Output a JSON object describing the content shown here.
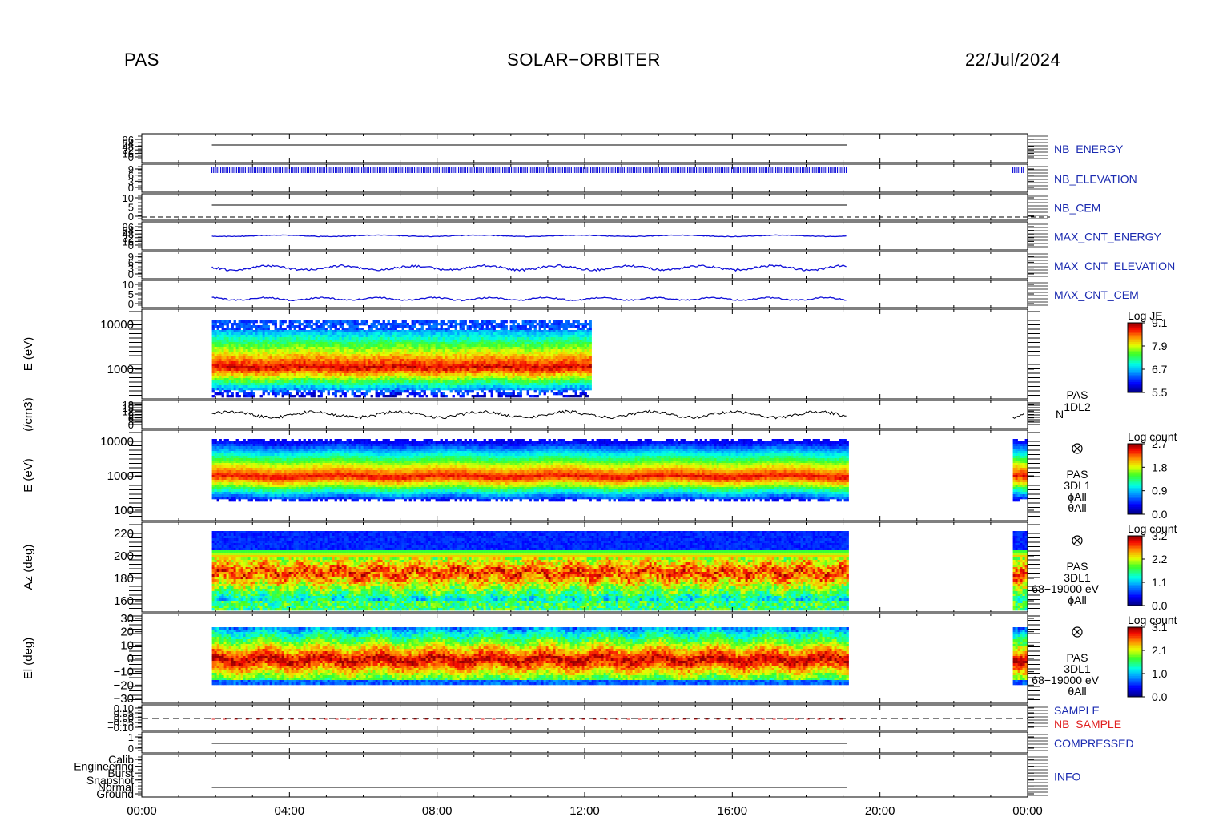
{
  "header": {
    "instrument": "PAS",
    "mission": "SOLAR−ORBITER",
    "date": "22/Jul/2024"
  },
  "colors": {
    "hk_label": "#1a2ab0",
    "nb_sample_label": "#e02020",
    "trace": "#1010d8",
    "density_trace": "#000000",
    "gap_zero_line": "#000000"
  },
  "chart_data": {
    "type": "heatmap",
    "x_axis": {
      "ticks": [
        "00:00",
        "04:00",
        "08:00",
        "12:00",
        "16:00",
        "20:00",
        "00:00"
      ],
      "range_hours": [
        0,
        24
      ]
    },
    "data_intervals_hours": {
      "main": [
        1.9,
        19.1
      ],
      "e_spectrogram_l2": [
        1.9,
        12.15
      ],
      "late": [
        23.6,
        24.0
      ]
    },
    "panels": [
      {
        "id": "nb_energy",
        "label": "NB_ENERGY",
        "kind": "line",
        "ticks": [
          "96",
          "64",
          "48",
          "32",
          "16",
          "0"
        ]
      },
      {
        "id": "nb_elevation",
        "label": "NB_ELEVATION",
        "kind": "comb",
        "ticks": [
          "9",
          "6",
          "3",
          "0"
        ]
      },
      {
        "id": "nb_cem",
        "label": "NB_CEM",
        "kind": "line",
        "ticks": [
          "10",
          "5",
          "0"
        ]
      },
      {
        "id": "max_cnt_energy",
        "label": "MAX_CNT_ENERGY",
        "kind": "line",
        "ticks": [
          "96",
          "64",
          "48",
          "32",
          "16",
          "0"
        ]
      },
      {
        "id": "max_cnt_elevation",
        "label": "MAX_CNT_ELEVATION",
        "kind": "line",
        "ticks": [
          "9",
          "6",
          "3",
          "0"
        ]
      },
      {
        "id": "max_cnt_cem",
        "label": "MAX_CNT_CEM",
        "kind": "line",
        "ticks": [
          "10",
          "5",
          "0"
        ]
      },
      {
        "id": "energy_l2",
        "kind": "spectrogram",
        "ylabel": "E (eV)",
        "yscale": "log",
        "yticks": [
          "10000",
          "1000"
        ],
        "ylim": [
          250,
          11000
        ],
        "peak_ev": 1000,
        "colorbar": {
          "title": "Log JE",
          "ticks": [
            "9.1",
            "7.9",
            "6.7",
            "5.5"
          ],
          "range": [
            5.5,
            9.1
          ]
        }
      },
      {
        "id": "density",
        "kind": "line",
        "ylabel": "(/cm3)",
        "yticks": [
          "18",
          "15",
          "12",
          "9",
          "6",
          "3",
          "0"
        ],
        "side_labels": [
          "PAS",
          "1DL2",
          "N"
        ]
      },
      {
        "id": "energy_l1",
        "kind": "spectrogram",
        "ylabel": "E (eV)",
        "yscale": "log",
        "yticks": [
          "10000",
          "1000",
          "100"
        ],
        "ylim": [
          80,
          12000
        ],
        "peak_ev": 1000,
        "colorbar": {
          "title": "Log count",
          "ticks": [
            "2.7",
            "1.8",
            "0.9",
            "0.0"
          ],
          "range": [
            0.0,
            2.7
          ]
        },
        "side_labels": [
          "PAS",
          "3DL1",
          "ϕAll",
          "θAll"
        ]
      },
      {
        "id": "azimuth",
        "kind": "spectrogram",
        "ylabel": "Az (deg)",
        "yticks": [
          "220",
          "200",
          "180",
          "160"
        ],
        "ylim": [
          155,
          226
        ],
        "colorbar": {
          "title": "Log count",
          "ticks": [
            "3.2",
            "2.2",
            "1.1",
            "0.0"
          ],
          "range": [
            0.0,
            3.2
          ]
        },
        "side_labels": [
          "PAS",
          "3DL1",
          "68−19000 eV",
          "ϕAll"
        ]
      },
      {
        "id": "elevation",
        "kind": "spectrogram",
        "ylabel": "El (deg)",
        "yticks": [
          "30",
          "20",
          "10",
          "0",
          "−10",
          "−20",
          "−30"
        ],
        "ylim": [
          -30,
          30
        ],
        "colorbar": {
          "title": "Log count",
          "ticks": [
            "3.1",
            "2.1",
            "1.0",
            "0.0"
          ],
          "range": [
            0.0,
            3.1
          ]
        },
        "side_labels": [
          "PAS",
          "3DL1",
          "68−19000 eV",
          "θAll"
        ]
      },
      {
        "id": "sample",
        "label": "SAMPLE",
        "label2": "NB_SAMPLE",
        "kind": "line",
        "ticks": [
          "0.10",
          "0.05",
          "0.00",
          "−0.05",
          "−0.10"
        ]
      },
      {
        "id": "compressed",
        "label": "COMPRESSED",
        "kind": "line",
        "ticks": [
          "1",
          "0"
        ]
      },
      {
        "id": "info",
        "label": "INFO",
        "kind": "line",
        "ticks": [
          "Calib",
          "Engineering",
          "Burst",
          "Snapshot",
          "Normal",
          "Ground"
        ]
      }
    ]
  }
}
